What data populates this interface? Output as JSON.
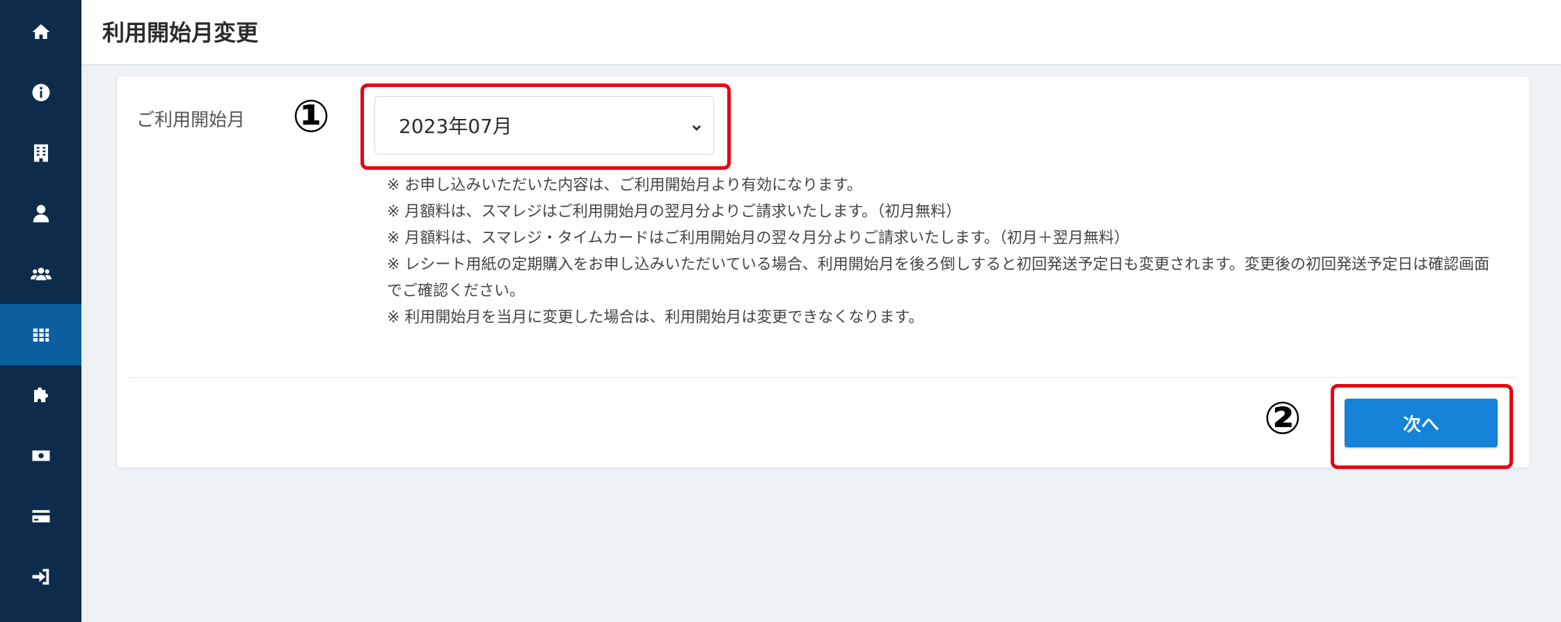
{
  "header": {
    "title": "利用開始月変更"
  },
  "sidebar": {
    "items": [
      {
        "icon": "home-icon"
      },
      {
        "icon": "info-icon"
      },
      {
        "icon": "building-icon"
      },
      {
        "icon": "user-icon"
      },
      {
        "icon": "users-icon"
      },
      {
        "icon": "grid-icon",
        "active": true
      },
      {
        "icon": "puzzle-icon"
      },
      {
        "icon": "money-icon"
      },
      {
        "icon": "credit-card-icon"
      },
      {
        "icon": "sign-in-icon"
      }
    ]
  },
  "form": {
    "label": "ご利用開始月",
    "selected_month": "2023年07月"
  },
  "notes": [
    "※ お申し込みいただいた内容は、ご利用開始月より有効になります。",
    "※ 月額料は、スマレジはご利用開始月の翌月分よりご請求いたします。（初月無料）",
    "※ 月額料は、スマレジ・タイムカードはご利用開始月の翌々月分よりご請求いたします。（初月＋翌月無料）",
    "※ レシート用紙の定期購入をお申し込みいただいている場合、利用開始月を後ろ倒しすると初回発送予定日も変更されます。変更後の初回発送予定日は確認画面でご確認ください。",
    "※ 利用開始月を当月に変更した場合は、利用開始月は変更できなくなります。"
  ],
  "annotations": {
    "marker_1": "①",
    "marker_2": "②"
  },
  "buttons": {
    "next": "次へ"
  },
  "colors": {
    "sidebar": "#0d2c4b",
    "sidebar_active": "#0b5f9f",
    "primary": "#1483d8",
    "highlight": "#e60012"
  }
}
